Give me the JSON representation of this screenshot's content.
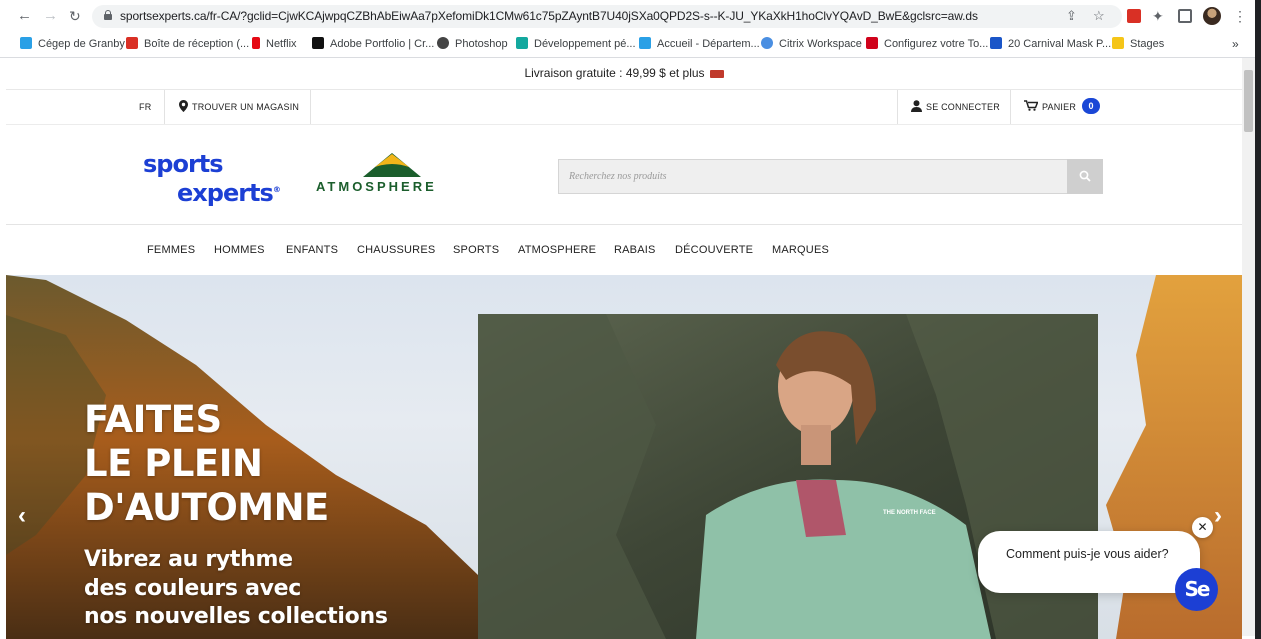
{
  "browser": {
    "url": "sportsexperts.ca/fr-CA/?gclid=CjwKCAjwpqCZBhAbEiwAa7pXefomiDk1CMw61c75pZAyntB7U40jSXa0QPD2S-s--K-JU_YKaXkH1hoClvYQAvD_BwE&gclsrc=aw.ds",
    "bookmarks": [
      {
        "label": "Cégep de Granby",
        "color": "#2aa0e6"
      },
      {
        "label": "Boîte de réception (...",
        "color": "#d93025"
      },
      {
        "label": "Netflix",
        "color": "#e50914"
      },
      {
        "label": "Adobe Portfolio | Cr...",
        "color": "#111111"
      },
      {
        "label": "Photoshop",
        "color": "#444444"
      },
      {
        "label": "Développement pé...",
        "color": "#13a89e"
      },
      {
        "label": "Accueil - Départem...",
        "color": "#2aa0e6"
      },
      {
        "label": "Citrix Workspace",
        "color": "#4a8fe2"
      },
      {
        "label": "Configurez votre To...",
        "color": "#d0021b"
      },
      {
        "label": "20 Carnival Mask P...",
        "color": "#1a55c8"
      },
      {
        "label": "Stages",
        "color": "#f5c518"
      }
    ],
    "more_bookmarks": "»"
  },
  "promo": {
    "text": "Livraison gratuite : 49,99 $ et plus"
  },
  "utility": {
    "lang": "FR",
    "store_finder": "TROUVER UN MAGASIN",
    "login": "SE CONNECTER",
    "cart": "PANIER",
    "cart_count": "0"
  },
  "header": {
    "logo_line1": "sports",
    "logo_line2": "experts",
    "logo_reg": "®",
    "atmosphere": "ATMOSPHERE",
    "search_placeholder": "Recherchez nos produits"
  },
  "nav": [
    "FEMMES",
    "HOMMES",
    "ENFANTS",
    "CHAUSSURES",
    "SPORTS",
    "ATMOSPHERE",
    "RABAIS",
    "DÉCOUVERTE",
    "MARQUES"
  ],
  "hero": {
    "title_l1": "FAITES",
    "title_l2": "LE PLEIN",
    "title_l3": "D'AUTOMNE",
    "sub_l1": "Vibrez au rythme",
    "sub_l2": "des couleurs avec",
    "sub_l3": "nos nouvelles collections",
    "jacket_brand": "THE NORTH FACE"
  },
  "chat": {
    "message": "Comment puis-je vous aider?",
    "close": "✕",
    "logo": "Se"
  },
  "colors": {
    "brand_blue": "#1c3fd4",
    "atmosphere_green": "#1b5e2c",
    "atmosphere_yellow": "#f2b51a"
  }
}
